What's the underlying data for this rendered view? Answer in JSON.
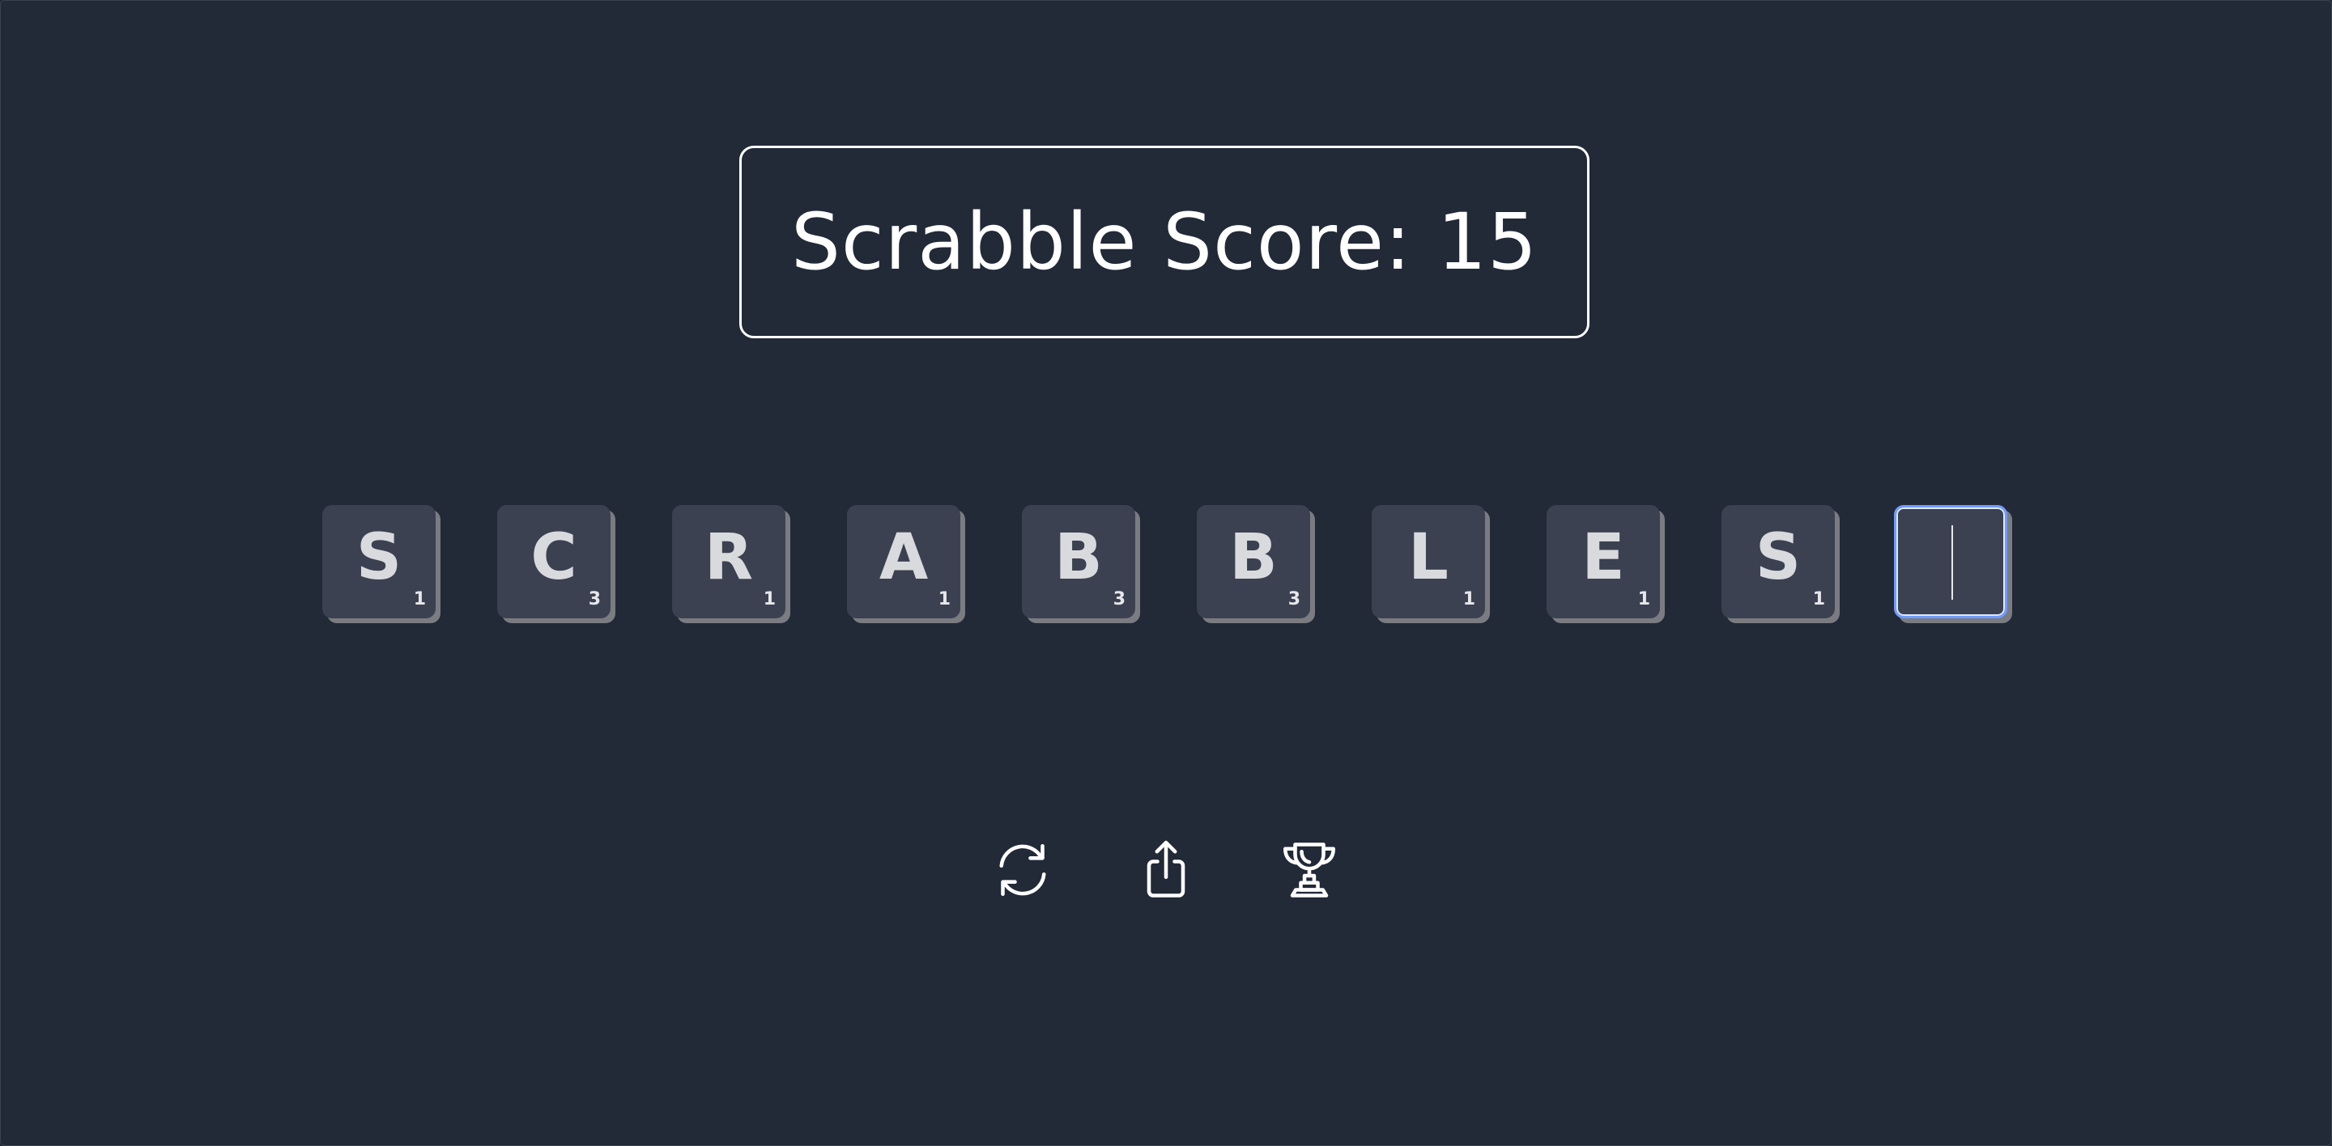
{
  "score": {
    "label": "Scrabble Score: 15"
  },
  "tiles": [
    {
      "letter": "S",
      "points": "1"
    },
    {
      "letter": "C",
      "points": "3"
    },
    {
      "letter": "R",
      "points": "1"
    },
    {
      "letter": "A",
      "points": "1"
    },
    {
      "letter": "B",
      "points": "3"
    },
    {
      "letter": "B",
      "points": "3"
    },
    {
      "letter": "L",
      "points": "1"
    },
    {
      "letter": "E",
      "points": "1"
    },
    {
      "letter": "S",
      "points": "1"
    }
  ],
  "input": {
    "value": ""
  },
  "actions": [
    {
      "icon": "refresh-icon"
    },
    {
      "icon": "share-icon"
    },
    {
      "icon": "trophy-icon"
    }
  ],
  "colors": {
    "background": "#222937",
    "tile": "#3b4150",
    "tile_shadow": "#7a7c81",
    "focus_ring": "#6f9bff",
    "text": "#ffffff"
  }
}
